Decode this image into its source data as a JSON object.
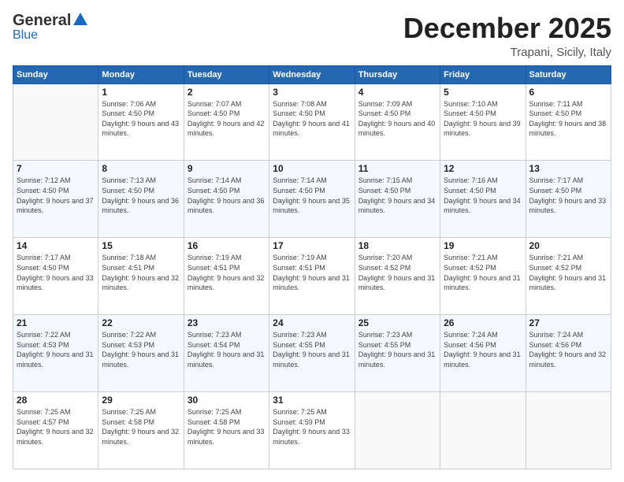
{
  "header": {
    "logo_general": "General",
    "logo_blue": "Blue",
    "month_title": "December 2025",
    "location": "Trapani, Sicily, Italy"
  },
  "weekdays": [
    "Sunday",
    "Monday",
    "Tuesday",
    "Wednesday",
    "Thursday",
    "Friday",
    "Saturday"
  ],
  "weeks": [
    [
      {
        "day": "",
        "sunrise": "",
        "sunset": "",
        "daylight": ""
      },
      {
        "day": "1",
        "sunrise": "7:06 AM",
        "sunset": "4:50 PM",
        "daylight": "9 hours and 43 minutes."
      },
      {
        "day": "2",
        "sunrise": "7:07 AM",
        "sunset": "4:50 PM",
        "daylight": "9 hours and 42 minutes."
      },
      {
        "day": "3",
        "sunrise": "7:08 AM",
        "sunset": "4:50 PM",
        "daylight": "9 hours and 41 minutes."
      },
      {
        "day": "4",
        "sunrise": "7:09 AM",
        "sunset": "4:50 PM",
        "daylight": "9 hours and 40 minutes."
      },
      {
        "day": "5",
        "sunrise": "7:10 AM",
        "sunset": "4:50 PM",
        "daylight": "9 hours and 39 minutes."
      },
      {
        "day": "6",
        "sunrise": "7:11 AM",
        "sunset": "4:50 PM",
        "daylight": "9 hours and 38 minutes."
      }
    ],
    [
      {
        "day": "7",
        "sunrise": "7:12 AM",
        "sunset": "4:50 PM",
        "daylight": "9 hours and 37 minutes."
      },
      {
        "day": "8",
        "sunrise": "7:13 AM",
        "sunset": "4:50 PM",
        "daylight": "9 hours and 36 minutes."
      },
      {
        "day": "9",
        "sunrise": "7:14 AM",
        "sunset": "4:50 PM",
        "daylight": "9 hours and 36 minutes."
      },
      {
        "day": "10",
        "sunrise": "7:14 AM",
        "sunset": "4:50 PM",
        "daylight": "9 hours and 35 minutes."
      },
      {
        "day": "11",
        "sunrise": "7:15 AM",
        "sunset": "4:50 PM",
        "daylight": "9 hours and 34 minutes."
      },
      {
        "day": "12",
        "sunrise": "7:16 AM",
        "sunset": "4:50 PM",
        "daylight": "9 hours and 34 minutes."
      },
      {
        "day": "13",
        "sunrise": "7:17 AM",
        "sunset": "4:50 PM",
        "daylight": "9 hours and 33 minutes."
      }
    ],
    [
      {
        "day": "14",
        "sunrise": "7:17 AM",
        "sunset": "4:50 PM",
        "daylight": "9 hours and 33 minutes."
      },
      {
        "day": "15",
        "sunrise": "7:18 AM",
        "sunset": "4:51 PM",
        "daylight": "9 hours and 32 minutes."
      },
      {
        "day": "16",
        "sunrise": "7:19 AM",
        "sunset": "4:51 PM",
        "daylight": "9 hours and 32 minutes."
      },
      {
        "day": "17",
        "sunrise": "7:19 AM",
        "sunset": "4:51 PM",
        "daylight": "9 hours and 31 minutes."
      },
      {
        "day": "18",
        "sunrise": "7:20 AM",
        "sunset": "4:52 PM",
        "daylight": "9 hours and 31 minutes."
      },
      {
        "day": "19",
        "sunrise": "7:21 AM",
        "sunset": "4:52 PM",
        "daylight": "9 hours and 31 minutes."
      },
      {
        "day": "20",
        "sunrise": "7:21 AM",
        "sunset": "4:52 PM",
        "daylight": "9 hours and 31 minutes."
      }
    ],
    [
      {
        "day": "21",
        "sunrise": "7:22 AM",
        "sunset": "4:53 PM",
        "daylight": "9 hours and 31 minutes."
      },
      {
        "day": "22",
        "sunrise": "7:22 AM",
        "sunset": "4:53 PM",
        "daylight": "9 hours and 31 minutes."
      },
      {
        "day": "23",
        "sunrise": "7:23 AM",
        "sunset": "4:54 PM",
        "daylight": "9 hours and 31 minutes."
      },
      {
        "day": "24",
        "sunrise": "7:23 AM",
        "sunset": "4:55 PM",
        "daylight": "9 hours and 31 minutes."
      },
      {
        "day": "25",
        "sunrise": "7:23 AM",
        "sunset": "4:55 PM",
        "daylight": "9 hours and 31 minutes."
      },
      {
        "day": "26",
        "sunrise": "7:24 AM",
        "sunset": "4:56 PM",
        "daylight": "9 hours and 31 minutes."
      },
      {
        "day": "27",
        "sunrise": "7:24 AM",
        "sunset": "4:56 PM",
        "daylight": "9 hours and 32 minutes."
      }
    ],
    [
      {
        "day": "28",
        "sunrise": "7:25 AM",
        "sunset": "4:57 PM",
        "daylight": "9 hours and 32 minutes."
      },
      {
        "day": "29",
        "sunrise": "7:25 AM",
        "sunset": "4:58 PM",
        "daylight": "9 hours and 32 minutes."
      },
      {
        "day": "30",
        "sunrise": "7:25 AM",
        "sunset": "4:58 PM",
        "daylight": "9 hours and 33 minutes."
      },
      {
        "day": "31",
        "sunrise": "7:25 AM",
        "sunset": "4:59 PM",
        "daylight": "9 hours and 33 minutes."
      },
      {
        "day": "",
        "sunrise": "",
        "sunset": "",
        "daylight": ""
      },
      {
        "day": "",
        "sunrise": "",
        "sunset": "",
        "daylight": ""
      },
      {
        "day": "",
        "sunrise": "",
        "sunset": "",
        "daylight": ""
      }
    ]
  ],
  "labels": {
    "sunrise_prefix": "Sunrise: ",
    "sunset_prefix": "Sunset: ",
    "daylight_prefix": "Daylight: "
  }
}
